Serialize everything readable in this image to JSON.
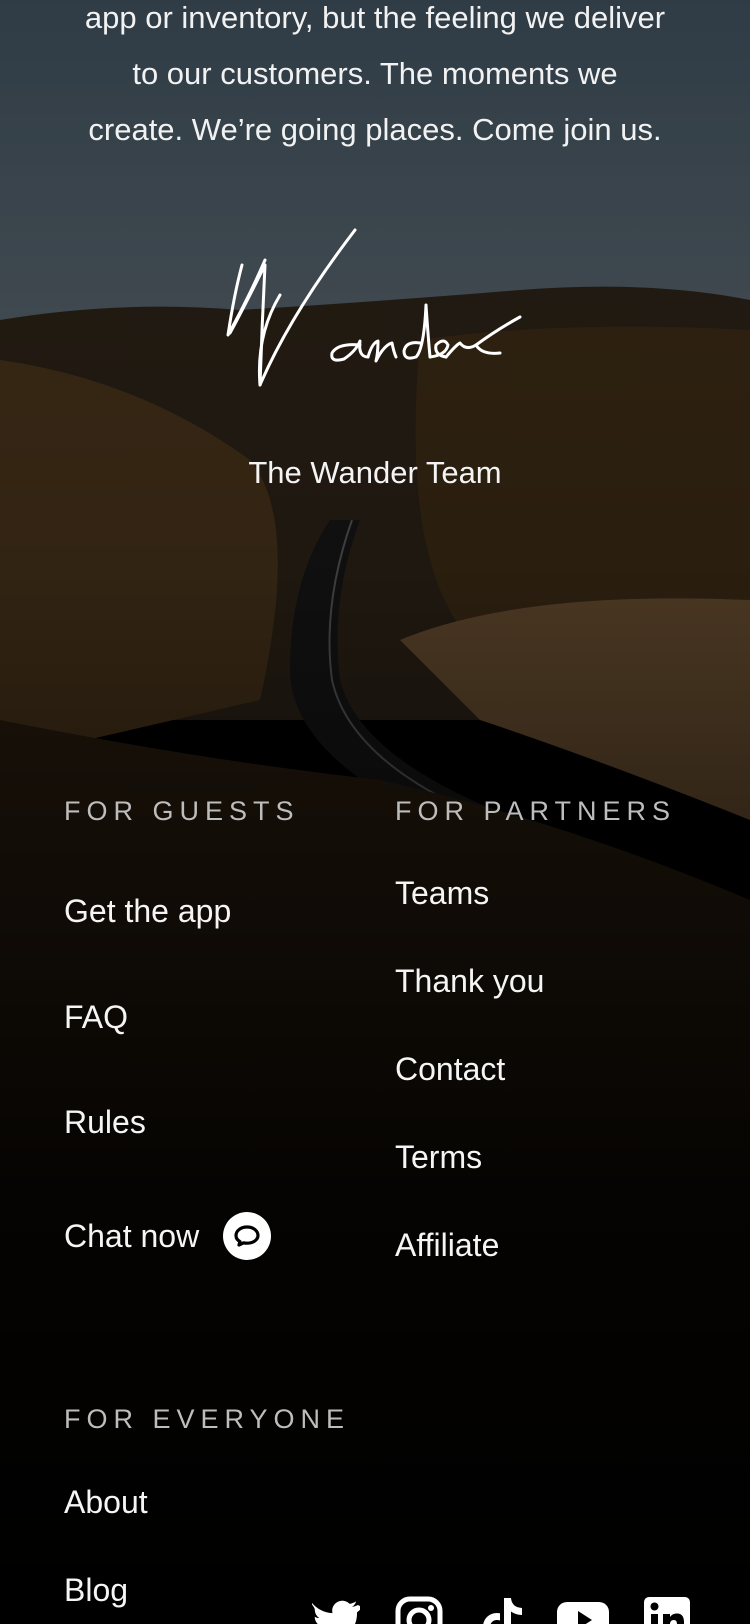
{
  "intro": {
    "line1": "app or inventory, but the feeling we deliver",
    "line2": "to our customers. The moments we",
    "line3": "create. We’re going places. Come join us."
  },
  "signature": {
    "text": "Wander"
  },
  "team": {
    "label": "The Wander Team"
  },
  "guests": {
    "heading": "FOR GUESTS",
    "links": [
      "Get the app",
      "FAQ",
      "Rules",
      "Chat now"
    ]
  },
  "partners": {
    "heading": "FOR PARTNERS",
    "links": [
      "Teams",
      "Thank you",
      "Contact",
      "Terms",
      "Affiliate"
    ]
  },
  "everyone": {
    "heading": "FOR EVERYONE",
    "links": [
      "About",
      "Blog"
    ]
  },
  "social": {
    "icons": [
      "twitter-icon",
      "instagram-icon",
      "tiktok-icon",
      "youtube-icon",
      "linkedin-icon"
    ]
  },
  "colors": {
    "background": "#000000",
    "text": "#ffffff",
    "heading": "#bdbdbd",
    "sky": "#4d5b66",
    "hills": "#3a2a17"
  }
}
